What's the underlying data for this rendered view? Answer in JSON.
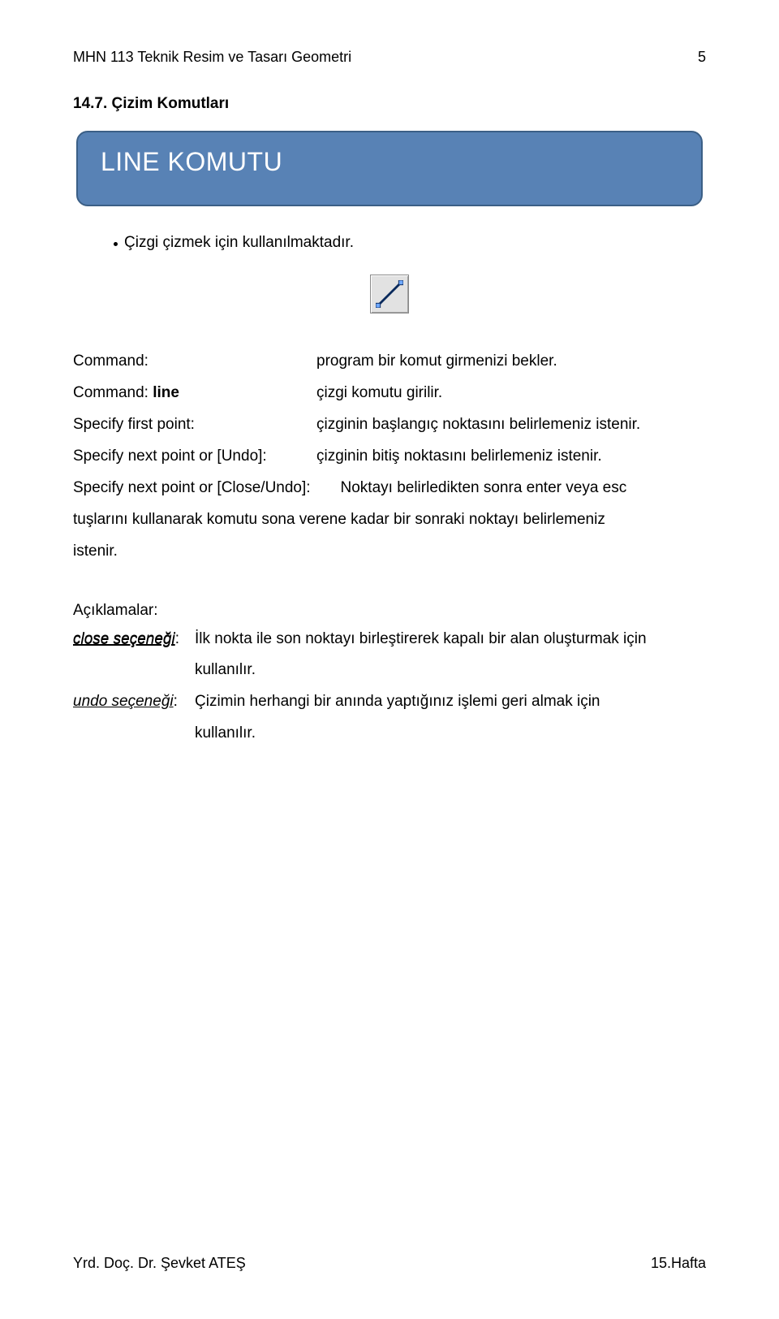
{
  "header": {
    "course": "MHN 113 Teknik Resim ve Tasarı Geometri",
    "page_no": "5"
  },
  "section": {
    "number_title": "14.7. Çizim Komutları"
  },
  "callout": {
    "title": "LINE KOMUTU"
  },
  "bullet": {
    "text": "Çizgi çizmek için kullanılmaktadır."
  },
  "icon": {
    "name": "line-tool-icon"
  },
  "commands": {
    "r1": {
      "left": "Command:",
      "right": "program bir komut girmenizi bekler."
    },
    "r2": {
      "left_prefix": "Command: ",
      "left_bold": "line",
      "right": "çizgi komutu girilir."
    },
    "r3": {
      "left": "Specify first point:",
      "right": "çizginin başlangıç noktasını belirlemeniz istenir."
    },
    "r4": {
      "left": "Specify next point or [Undo]:",
      "right": "çizginin bitiş noktasını belirlemeniz istenir."
    },
    "r5a": "Specify next point or [Close/Undo]:",
    "r5b": "Noktayı belirledikten sonra enter veya esc",
    "r6": "tuşlarını kullanarak komutu sona verene kadar bir sonraki noktayı belirlemeniz",
    "r7": "istenir."
  },
  "explain": {
    "heading": "Açıklamalar:",
    "close": {
      "label": "close seçeneği",
      "colon": ":",
      "line1": "İlk nokta ile son noktayı birleştirerek kapalı bir alan oluşturmak için",
      "line2": "kullanılır."
    },
    "undo": {
      "label": "undo seçeneği",
      "colon": ":",
      "line1": "Çizimin herhangi bir anında yaptığınız işlemi geri almak için",
      "line2": "kullanılır."
    }
  },
  "footer": {
    "author": "Yrd. Doç. Dr. Şevket ATEŞ",
    "week": "15.Hafta"
  }
}
